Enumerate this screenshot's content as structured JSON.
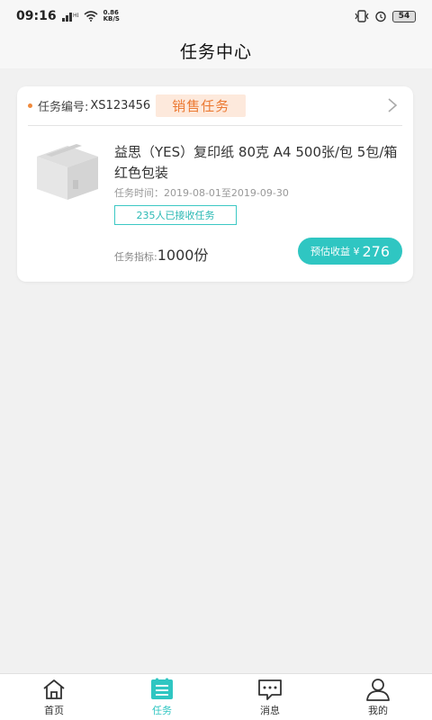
{
  "status_bar": {
    "time": "09:16",
    "net_speed_value": "0.86",
    "net_speed_unit": "KB/S",
    "battery": "54"
  },
  "header": {
    "title": "任务中心"
  },
  "task": {
    "number_label": "任务编号:",
    "number": "XS123456",
    "type": "销售任务",
    "product_title": "益思（YES）复印纸 80克 A4 500张/包 5包/箱 红色包装",
    "period": "任务时间：2019-08-01至2019-09-30",
    "accepted": "235人已接收任务",
    "target_label": "任务指标:",
    "target_value": "1000份",
    "income_label": "预估收益 ¥",
    "income_value": "276"
  },
  "tabs": [
    {
      "label": "首页",
      "icon": "home-icon"
    },
    {
      "label": "任务",
      "icon": "task-icon",
      "active": true
    },
    {
      "label": "消息",
      "icon": "message-icon"
    },
    {
      "label": "我的",
      "icon": "user-icon"
    }
  ],
  "colors": {
    "accent": "#2fc6c2",
    "badge_orange": "#ec7a34",
    "badge_orange_bg": "#fde9dc"
  }
}
